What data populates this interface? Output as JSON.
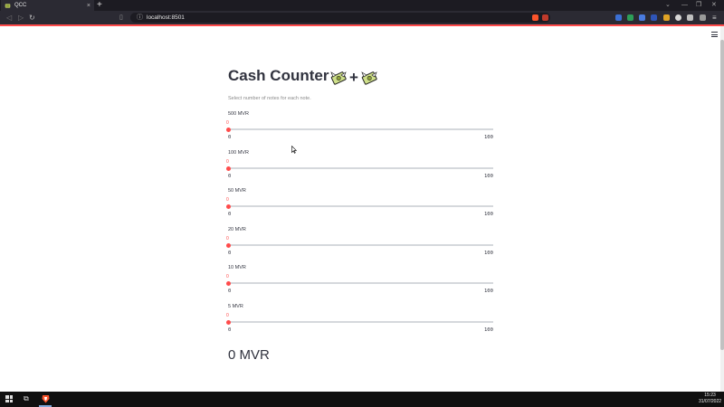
{
  "browser": {
    "tab_title": "QCC",
    "tab_close": "×",
    "new_tab": "+",
    "url": "localhost:8501",
    "window_controls": [
      "⌄",
      "—",
      "❐",
      "✕"
    ]
  },
  "app": {
    "title": "Cash Counter",
    "plus": "+",
    "subtitle": "Select number of notes for each note.",
    "sliders": [
      {
        "label": "500 MVR",
        "value": "0",
        "min": "0",
        "max": "100"
      },
      {
        "label": "100 MVR",
        "value": "0",
        "min": "0",
        "max": "100"
      },
      {
        "label": "50 MVR",
        "value": "0",
        "min": "0",
        "max": "100"
      },
      {
        "label": "20 MVR",
        "value": "0",
        "min": "0",
        "max": "100"
      },
      {
        "label": "10 MVR",
        "value": "0",
        "min": "0",
        "max": "100"
      },
      {
        "label": "5 MVR",
        "value": "0",
        "min": "0",
        "max": "100"
      }
    ],
    "total": "0 MVR"
  },
  "taskbar": {
    "time": "15:23",
    "date": "31/07/2022"
  },
  "colors": {
    "accent": "#ff4b4b",
    "text": "#31333f",
    "chrome_dark": "#1c1b22",
    "chrome": "#2b2a33"
  }
}
